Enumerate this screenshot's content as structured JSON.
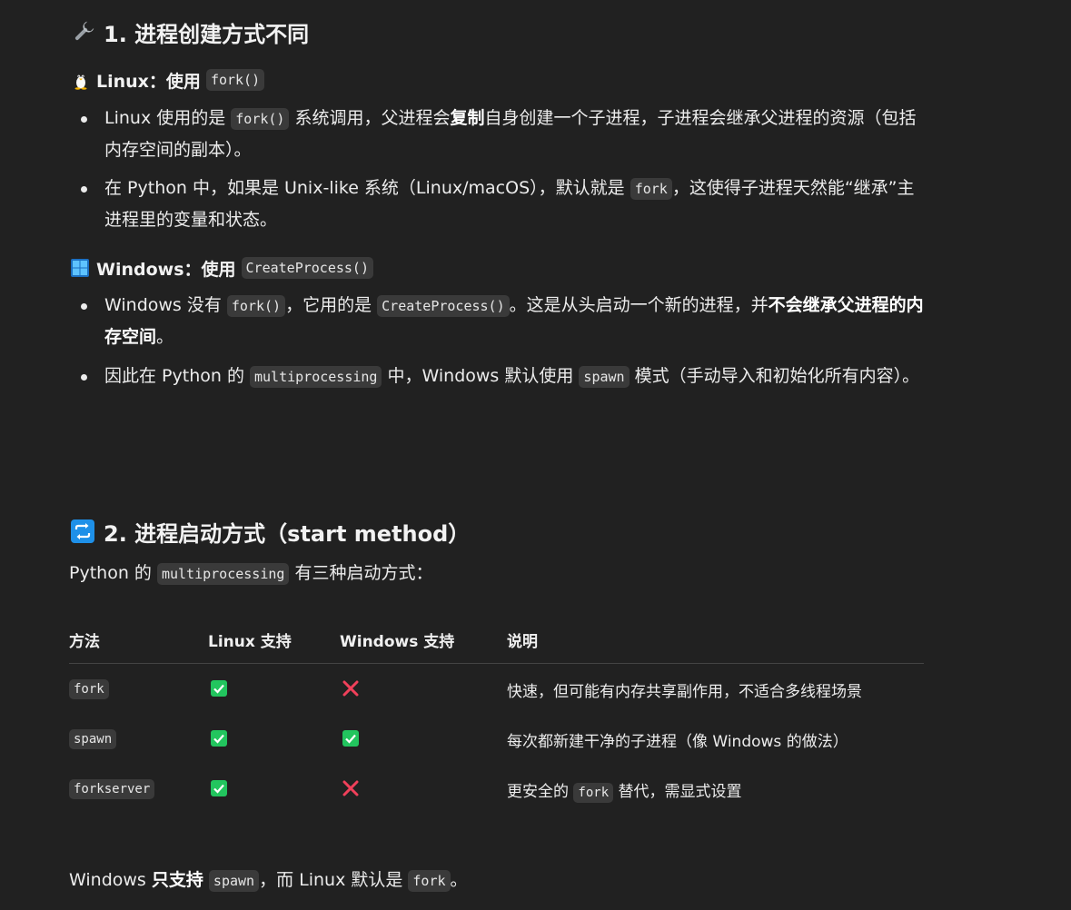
{
  "section1": {
    "icon": "wrench-icon",
    "title": "1. 进程创建方式不同",
    "linux": {
      "icon": "penguin-icon",
      "heading": "Linux：使用",
      "code": "fork()",
      "b1": {
        "t1": "Linux 使用的是",
        "code": "fork()",
        "t2": "系统调用，父进程会",
        "bold": "复制",
        "t3": "自身创建一个子进程，子进程会继承父进程的资源（包括内存空间的副本）。"
      },
      "b2": {
        "t1": "在 Python 中，如果是 Unix-like 系统（Linux/macOS），默认就是",
        "code": "fork",
        "t2": "，这使得子进程天然能“继承”主进程里的变量和状态。"
      }
    },
    "windows": {
      "icon": "windows-logo-icon",
      "heading": "Windows：使用",
      "code": "CreateProcess()",
      "b1": {
        "t1": "Windows 没有",
        "code1": "fork()",
        "t2": "，它用的是",
        "code2": "CreateProcess()",
        "t3": "。这是从头启动一个新的进程，并",
        "bold": "不会继承父进程的内存空间",
        "t4": "。"
      },
      "b2": {
        "t1": "因此在 Python 的",
        "code1": "multiprocessing",
        "t2": "中，Windows 默认使用",
        "code2": "spawn",
        "t3": "模式（手动导入和初始化所有内容）。"
      }
    }
  },
  "section2": {
    "icon": "repeat-arrows-icon",
    "title": "2. 进程启动方式（start method）",
    "intro": {
      "t1": "Python 的",
      "code": "multiprocessing",
      "t2": "有三种启动方式："
    },
    "table": {
      "headers": [
        "方法",
        "Linux 支持",
        "Windows 支持",
        "说明"
      ],
      "rows": [
        {
          "method": "fork",
          "linux": "✅",
          "windows": "❌",
          "desc": {
            "t1": "快速，但可能有内存共享副作用，不适合多线程场景",
            "code": "",
            "t2": ""
          }
        },
        {
          "method": "spawn",
          "linux": "✅",
          "windows": "✅",
          "desc": {
            "t1": "每次都新建干净的子进程（像 Windows 的做法）",
            "code": "",
            "t2": ""
          }
        },
        {
          "method": "forkserver",
          "linux": "✅",
          "windows": "❌",
          "desc": {
            "t1": "更安全的",
            "code": "fork",
            "t2": "替代，需显式设置"
          }
        }
      ]
    },
    "summary": {
      "t1": "Windows ",
      "bold": "只支持",
      "code1": "spawn",
      "t2": "，而 Linux 默认是",
      "code2": "fork",
      "t3": "。"
    }
  },
  "colors": {
    "background": "#212121",
    "text": "#ececec",
    "code_bg": "#3a3a3a",
    "check_green": "#22c55e",
    "cross_red": "#f0405a",
    "windows_blue": "#3fa9f5",
    "repeat_blue": "#1e90e8"
  }
}
